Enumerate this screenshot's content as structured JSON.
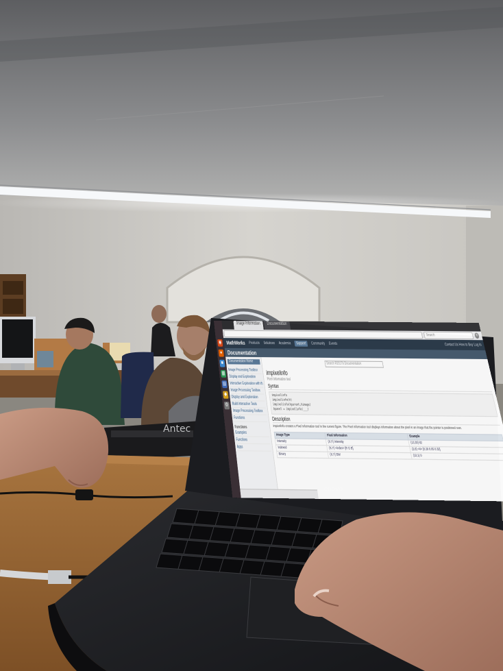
{
  "browser": {
    "active_tab": "Image Information",
    "inactive_tab": "Documentation",
    "url": "",
    "search_placeholder": "Search"
  },
  "site": {
    "logo": "MathWorks",
    "nav": [
      "Products",
      "Solutions",
      "Academia",
      "Support",
      "Community",
      "Events"
    ],
    "active_nav": "Support",
    "account_links": "Contact Us   How to Buy   Log In",
    "section_title": "Documentation"
  },
  "sidebar": {
    "button": "Documentation Home",
    "items": [
      "Image Processing Toolbox",
      "Display and Exploration",
      "Interactive Exploration with the Image Viewer App",
      "Image Processing Toolbox",
      "Display and Exploration",
      "Build Interactive Tools",
      "Image Processing Toolbox",
      "Functions"
    ],
    "section_head": "Functions",
    "links": [
      "Examples",
      "Functions",
      "Apps"
    ]
  },
  "content": {
    "search_placeholder": "Search R2017b Documentation",
    "title": "impixelinfo",
    "breadcrumb": "Pixel Information tool",
    "syntax_heading": "Syntax",
    "syntax_lines": [
      "impixelinfo",
      "impixelinfo(h)",
      "impixelinfo(hparent,himage)",
      "hpanel = impixelinfo(___)"
    ],
    "description_heading": "Description",
    "description_text": "impixelinfo creates a Pixel Information tool in the current figure. The Pixel Information tool displays information about the pixel in an image that the pointer is positioned over.",
    "table_headers": [
      "Image Type",
      "Pixel Information",
      "Example"
    ],
    "table_rows": [
      [
        "Intensity",
        "(X,Y) Intensity",
        "(13,30) 82"
      ],
      [
        "Indexed",
        "(X,Y) <index> [R G B]",
        "(2,6) <4> [0.29 0.05 0.32]"
      ],
      [
        "Binary",
        "(X,Y) BW",
        "(12,1) 0"
      ]
    ],
    "status_text": ""
  }
}
